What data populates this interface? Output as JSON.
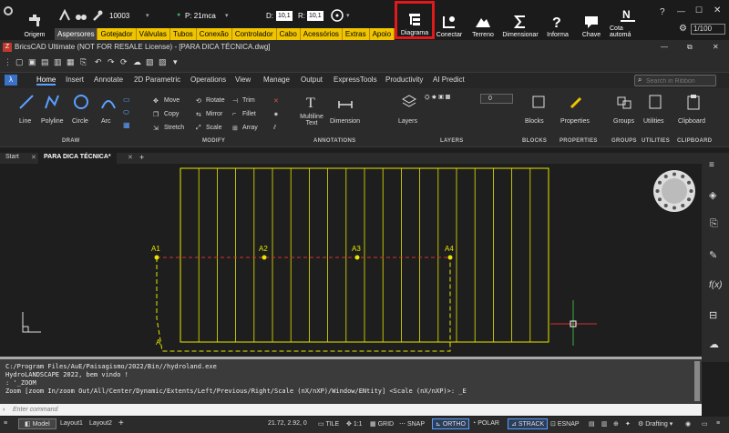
{
  "plugin": {
    "origem": "Origem",
    "code": "10003",
    "pressure": "P: 21mca",
    "d_label": "D:",
    "d_value": "10,1",
    "r_label": "R:",
    "r_value": "10,1",
    "menu": [
      "Aspersores",
      "Gotejador",
      "Válvulas",
      "Tubos",
      "Conexão",
      "Controlador",
      "Cabo",
      "Acessórios",
      "Extras",
      "Apoio"
    ],
    "buttons": [
      "Diagrama",
      "Conectar",
      "Terreno",
      "Dimensionar",
      "Informa",
      "Chave",
      "Cota automá"
    ],
    "scale": "1/100"
  },
  "titlebar": {
    "title": "BricsCAD Ultimate (NOT FOR RESALE License) - [PARA DICA TÉCNICA.dwg]"
  },
  "ribbon_tabs": [
    "Home",
    "Insert",
    "Annotate",
    "2D Parametric",
    "Operations",
    "View",
    "Manage",
    "Output",
    "ExpressTools",
    "Productivity",
    "AI Predict"
  ],
  "search": {
    "placeholder": "Search in Ribbon"
  },
  "ribbon": {
    "draw": [
      "Line",
      "Polyline",
      "Circle",
      "Arc"
    ],
    "modify": [
      "Move",
      "Rotate",
      "Trim",
      "Copy",
      "Mirror",
      "Fillet",
      "Stretch",
      "Scale",
      "Array"
    ],
    "annotations": [
      "Multiline Text",
      "Dimension"
    ],
    "layers": "Layers",
    "layer_value": "0",
    "right": [
      "Blocks",
      "Properties",
      "Groups",
      "Utilities",
      "Clipboard"
    ],
    "groups": [
      "DRAW",
      "MODIFY",
      "ANNOTATIONS",
      "LAYERS",
      "BLOCKS",
      "PROPERTIES",
      "GROUPS",
      "UTILITIES",
      "CLIPBOARD"
    ]
  },
  "doctabs": {
    "start": "Start",
    "active": "PARA DICA TÉCNICA*",
    "add": "+"
  },
  "drawing": {
    "labels": [
      "A1",
      "A2",
      "A3",
      "A4",
      "A"
    ]
  },
  "command": {
    "lines": [
      "C:/Program Files/AuE/Paisagismo/2022/Bin//hydroland.exe",
      "HydroLANDSCAPE 2022, bem vindo !",
      ": '_ZOOM",
      "Zoom [zoom In/zoom Out/All/Center/Dynamic/Extents/Left/Previous/Right/Scale (nX/nXP)/Window/ENtity] <Scale (nX/nXP)>: _E"
    ],
    "placeholder": "Enter command"
  },
  "status": {
    "tabs": [
      "Model",
      "Layout1",
      "Layout2",
      "+"
    ],
    "coords": "21.72, 2.92, 0",
    "toggles": [
      "TILE",
      "1:1",
      "GRID",
      "SNAP",
      "ORTHO",
      "POLAR",
      "STRACK",
      "ESNAP",
      "Drafting"
    ]
  },
  "colors": {
    "accent": "#e0191b",
    "drawing": "#e6e600",
    "dash": "#d83030"
  }
}
